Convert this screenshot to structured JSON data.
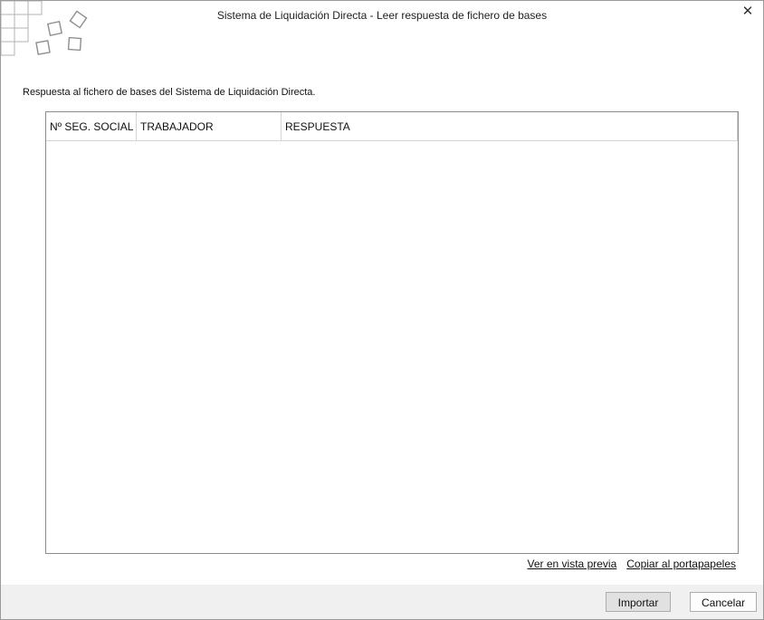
{
  "window": {
    "title": "Sistema de Liquidación Directa - Leer respuesta de fichero de bases",
    "close_symbol": "✕"
  },
  "icons": {
    "logo": "squares-logo-icon",
    "close": "close-icon"
  },
  "main": {
    "subtitle": "Respuesta al fichero de bases del Sistema de Liquidación Directa."
  },
  "table": {
    "columns": [
      "Nº SEG. SOCIAL",
      "TRABAJADOR",
      "RESPUESTA"
    ],
    "rows": []
  },
  "links": {
    "preview": "Ver en vista previa",
    "copy": "Copiar al portapapeles"
  },
  "buttons": {
    "import": "Importar",
    "cancel": "Cancelar"
  },
  "colors": {
    "footer_bg": "#f0f0f0",
    "border": "#8c8c8c",
    "logo_square": "#a8a8a8"
  }
}
